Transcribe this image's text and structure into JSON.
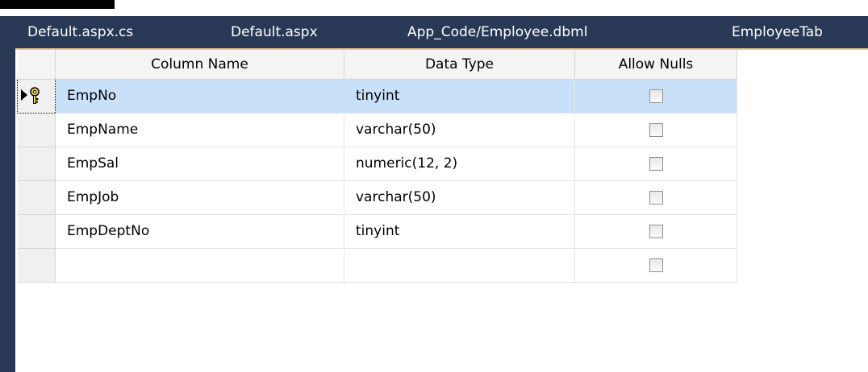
{
  "tabs": [
    {
      "label": "Default.aspx.cs"
    },
    {
      "label": "Default.aspx"
    },
    {
      "label": "App_Code/Employee.dbml"
    },
    {
      "label": "EmployeeTab"
    }
  ],
  "grid": {
    "headers": {
      "column_name": "Column Name",
      "data_type": "Data Type",
      "allow_nulls": "Allow Nulls"
    },
    "rows": [
      {
        "name": "EmpNo",
        "type": "tinyint",
        "allow_nulls": false,
        "primary_key": true,
        "selected": true
      },
      {
        "name": "EmpName",
        "type": "varchar(50)",
        "allow_nulls": false
      },
      {
        "name": "EmpSal",
        "type": "numeric(12, 2)",
        "allow_nulls": false
      },
      {
        "name": "EmpJob",
        "type": "varchar(50)",
        "allow_nulls": false
      },
      {
        "name": "EmpDeptNo",
        "type": "tinyint",
        "allow_nulls": false
      },
      {
        "name": "",
        "type": "",
        "allow_nulls": false
      }
    ]
  },
  "icons": {
    "row_pointer": "row-pointer-icon",
    "primary_key": "primary-key-icon"
  },
  "colors": {
    "ide_frame": "#293955",
    "selected_row": "#c9e1f8",
    "active_tab_underline": "#f5cc84"
  }
}
